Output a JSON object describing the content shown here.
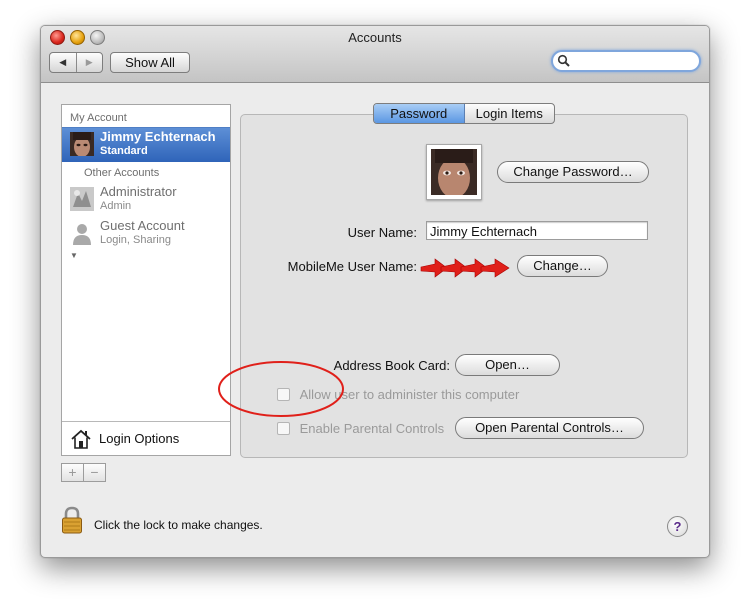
{
  "window": {
    "title": "Accounts"
  },
  "toolbar": {
    "back_icon": "◀",
    "forward_icon": "▶",
    "show_all": "Show All",
    "search_value": ""
  },
  "sidebar": {
    "my_account_header": "My Account",
    "other_accounts_header": "Other Accounts",
    "disclosure_icon": "▼",
    "accounts": [
      {
        "name": "Jimmy Echternach",
        "role": "Standard"
      },
      {
        "name": "Administrator",
        "role": "Admin"
      },
      {
        "name": "Guest Account",
        "role": "Login, Sharing"
      }
    ],
    "login_options": "Login Options",
    "add_label": "+",
    "remove_label": "−"
  },
  "tabs": [
    {
      "label": "Password"
    },
    {
      "label": "Login Items"
    }
  ],
  "password_pane": {
    "change_password": "Change Password…",
    "user_name_label": "User Name:",
    "user_name_value": "Jimmy Echternach",
    "mobileme_label": "MobileMe User Name:",
    "change_button": "Change…",
    "address_book_label": "Address Book Card:",
    "open_button": "Open…",
    "allow_admin_label": "Allow user to administer this computer",
    "parental_controls_label": "Enable Parental Controls",
    "open_parental_controls": "Open Parental Controls…"
  },
  "footer": {
    "lock_text": "Click the lock to make changes.",
    "help_label": "?"
  },
  "colors": {
    "selection": "#3a6fc4",
    "annotation_red": "#e0201a",
    "help_glyph": "#5a2b8a"
  }
}
